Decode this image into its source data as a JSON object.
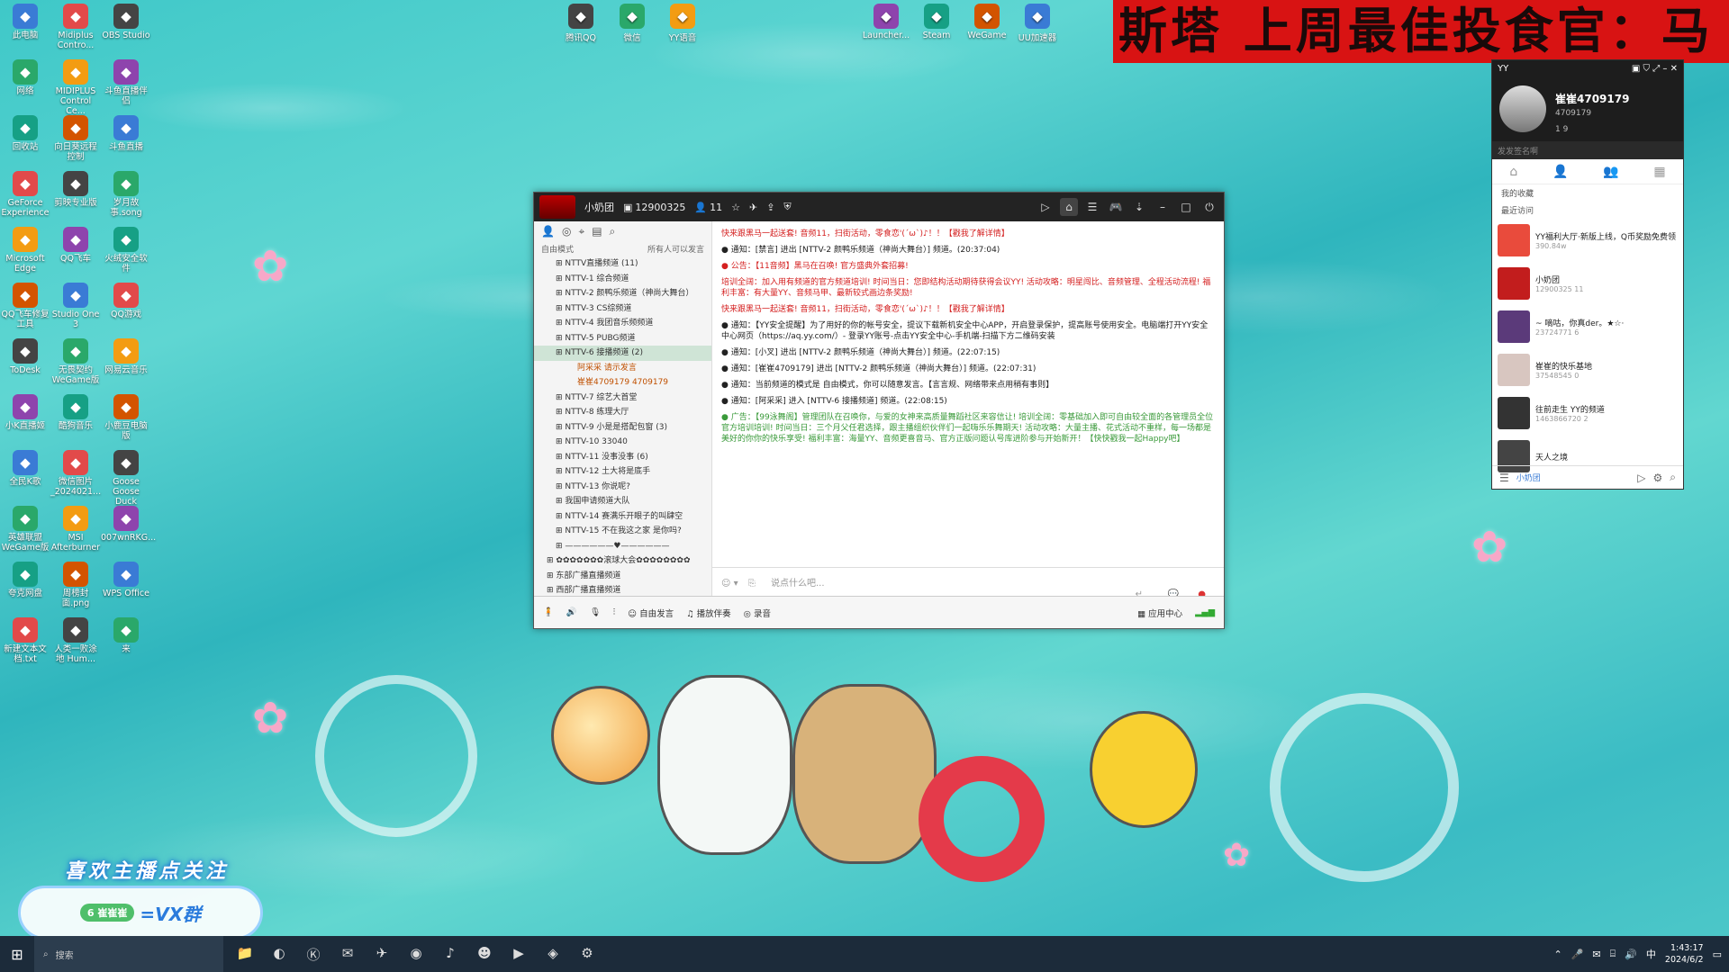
{
  "banner": {
    "text": "斯塔 上周最佳投食官：马"
  },
  "desktop_icons_left": [
    {
      "label": "此电脑",
      "icon": "computer-icon"
    },
    {
      "label": "Midiplus Contro...",
      "icon": "midi-icon"
    },
    {
      "label": "OBS Studio",
      "icon": "obs-icon"
    },
    {
      "label": "网络",
      "icon": "network-icon"
    },
    {
      "label": "MIDIPLUS Control Ce...",
      "icon": "midi-icon"
    },
    {
      "label": "斗鱼直播伴侣",
      "icon": "douyu-icon"
    },
    {
      "label": "回收站",
      "icon": "recycle-icon"
    },
    {
      "label": "向日葵远程控制",
      "icon": "sunflower-icon"
    },
    {
      "label": "斗鱼直播",
      "icon": "douyu-icon"
    },
    {
      "label": "GeForce Experience",
      "icon": "nvidia-icon"
    },
    {
      "label": "剪映专业版",
      "icon": "jianying-icon"
    },
    {
      "label": "岁月故事.song",
      "icon": "file-icon"
    },
    {
      "label": "Microsoft Edge",
      "icon": "edge-icon"
    },
    {
      "label": "QQ飞车",
      "icon": "qqspeed-icon"
    },
    {
      "label": "火绒安全软件",
      "icon": "huorong-icon"
    },
    {
      "label": "QQ飞车修复工具",
      "icon": "qqspeed-icon"
    },
    {
      "label": "Studio One 3",
      "icon": "studioone-icon"
    },
    {
      "label": "QQ游戏",
      "icon": "qqgame-icon"
    },
    {
      "label": "ToDesk",
      "icon": "todesk-icon"
    },
    {
      "label": "无畏契约 WeGame版",
      "icon": "valorant-icon"
    },
    {
      "label": "网易云音乐",
      "icon": "netease-icon"
    },
    {
      "label": "小K直播姬",
      "icon": "live-icon"
    },
    {
      "label": "酷狗音乐",
      "icon": "kugou-icon"
    },
    {
      "label": "小鹿豆电脑版",
      "icon": "app-icon"
    },
    {
      "label": "全民K歌",
      "icon": "ksong-icon"
    },
    {
      "label": "微信图片_2024021...",
      "icon": "image-icon"
    },
    {
      "label": "Goose Goose Duck",
      "icon": "goose-icon"
    },
    {
      "label": "英雄联盟 WeGame版",
      "icon": "lol-icon"
    },
    {
      "label": "MSI Afterburner",
      "icon": "msi-icon"
    },
    {
      "label": "007wnRKG...",
      "icon": "file-icon"
    },
    {
      "label": "夸克网盘",
      "icon": "quark-icon"
    },
    {
      "label": "周榜封面.png",
      "icon": "image-icon"
    },
    {
      "label": "WPS Office",
      "icon": "wps-icon"
    },
    {
      "label": "新建文本文档.txt",
      "icon": "txt-icon"
    },
    {
      "label": "人类一败涂地 Hum...",
      "icon": "human-icon"
    },
    {
      "label": "来",
      "icon": "file-icon"
    }
  ],
  "desktop_icons_top": [
    {
      "label": "腾讯QQ",
      "icon": "qq-icon"
    },
    {
      "label": "微信",
      "icon": "wechat-icon"
    },
    {
      "label": "YY语音",
      "icon": "yy-icon"
    },
    {
      "label": "Launcher...",
      "icon": "launcher-icon"
    },
    {
      "label": "Steam",
      "icon": "steam-icon"
    },
    {
      "label": "WeGame",
      "icon": "wegame-icon"
    },
    {
      "label": "UU加速器",
      "icon": "uu-icon"
    }
  ],
  "yy_main": {
    "channel_name": "小奶团",
    "channel_id": "12900325",
    "online_count": "11",
    "left_panel": {
      "mode": "自由模式",
      "mode_hint": "所有人可以发言",
      "channels": [
        {
          "label": "NTTV直播频道",
          "count": "(11)"
        },
        {
          "label": "NTTV-1 综合频道"
        },
        {
          "label": "NTTV-2 颜鸭乐频道（神尚大舞台）"
        },
        {
          "label": "NTTV-3 CS综频道"
        },
        {
          "label": "NTTV-4 我团音乐频频道"
        },
        {
          "label": "NTTV-5 PUBG频道"
        },
        {
          "label": "NTTV-6 接播频道",
          "count": "(2)",
          "selected": true
        },
        {
          "label": "阿采采",
          "user": true,
          "note": "请示发言"
        },
        {
          "label": "崔崔4709179",
          "user": true,
          "note": "4709179"
        },
        {
          "label": "NTTV-7 综艺大首堂"
        },
        {
          "label": "NTTV-8 练理大厅"
        },
        {
          "label": "NTTV-9 小是是搭配包窗",
          "count": "(3)"
        },
        {
          "label": "NTTV-10 33040"
        },
        {
          "label": "NTTV-11 没事没事",
          "count": "(6)"
        },
        {
          "label": "NTTV-12 土大将是底手"
        },
        {
          "label": "NTTV-13 你说呢?"
        },
        {
          "label": "我国申请频道大队"
        },
        {
          "label": "NTTV-14 赛满乐开眼子的叫肆空"
        },
        {
          "label": "NTTV-15 不在我这之家 是你吗?"
        },
        {
          "label": "——————♥——————"
        },
        {
          "label": "✿✿✿✿✿✿✿滚球大会✿✿✿✿✿✿✿✿",
          "cat": true
        },
        {
          "label": "东部广播直播频道",
          "cat": true
        },
        {
          "label": "西部广播直播频道",
          "cat": true
        }
      ]
    },
    "messages": [
      {
        "cls": "red",
        "text": "快来跟黑马一起送套! 音频11，扫街活动，零食恋'(´ω`)♪！！【戳我了解详情】"
      },
      {
        "cls": "blk",
        "text": "● 通知：[禁言] 进出 [NTTV-2 颜鸭乐频道（神尚大舞台）] 频道。(20:37:04)"
      },
      {
        "cls": "red",
        "text": "● 公告：【11音频】黑马在召唤! 官方盛典外套招募!"
      },
      {
        "cls": "red",
        "text": "培训全阔：加入用有频道的官方频道培训! 时间当日：您即结构活动期待获得会议YY! 活动攻略：明星闯比、音频管理、全程活动流程! 福利丰富：有大量YY、音频马甲、最新较式画边条奖励!"
      },
      {
        "cls": "red",
        "text": "快来跟黑马一起送套! 音频11，扫街活动，零食恋'(´ω`)♪！！【戳我了解详情】"
      },
      {
        "cls": "blk",
        "text": "● 通知：【YY安全提醒】为了用好的你的帐号安全，提议下载新机安全中心APP，开启登录保护，提高账号使用安全。电脑端打开YY安全中心网页（https://aq.yy.com/）- 登录YY账号-点击YY安全中心-手机端-扫描下方二维码安装"
      },
      {
        "cls": "blk",
        "text": "● 通知：[小叉] 进出 [NTTV-2 颜鸭乐频道（神尚大舞台）] 频道。(22:07:15)"
      },
      {
        "cls": "blk",
        "text": "● 通知：[崔崔4709179] 进出 [NTTV-2 颜鸭乐频道（神尚大舞台）] 频道。(22:07:31)"
      },
      {
        "cls": "blk",
        "text": "● 通知：当前频道的模式是 自由模式，你可以随意发言。【言言规、网络带来点用稍有事则】"
      },
      {
        "cls": "blk",
        "text": "● 通知：[阿采采] 进入 [NTTV-6 接播频道] 频道。(22:08:15)"
      },
      {
        "cls": "grn",
        "text": "● 广告：【99泳舞阁】管理团队在召唤你，与爱的女神来高质量舞蹈社区来容信让! 培训全阔：零基础加入即可自由较全面的各管理员全位官方培训培训! 时间当日：三个月父任君选择，跟主播组织伙伴们一起嗨乐乐舞期天! 活动攻略：大量主播、花式活动不重样，每一场都是美好的你你的快乐享受! 福利丰富：海量YY、音频更喜音马、官方正版问题认号库进阶参与开始新开！【快快戳我一起Happy吧】"
      }
    ],
    "input_placeholder": "说点什么吧...",
    "bottom": {
      "free_speak": "自由发言",
      "music": "播放伴奏",
      "record": "录音",
      "app_center": "应用中心"
    }
  },
  "yy_mini": {
    "title": "YY",
    "name": "崔崔4709179",
    "id": "4709179",
    "signature": "发发签名啊",
    "stats": "1  9",
    "sections": {
      "favorites": "我的收藏",
      "recent": "最近访问"
    },
    "recent": [
      {
        "title": "YY福利大厅·新版上线，Q币奖励免费领",
        "sub": "390.84w"
      },
      {
        "title": "小奶团",
        "sub": "12900325  11"
      },
      {
        "title": "~ 嘀咕，你真der。★☆·",
        "sub": "23724771  6"
      },
      {
        "title": "崔崔的快乐基地",
        "sub": "37548545  0"
      },
      {
        "title": "往前走生 YY的频道",
        "sub": "1463866720  2"
      },
      {
        "title": "天人之境",
        "sub": ""
      }
    ],
    "foot_label": "小奶团"
  },
  "overlay": {
    "follow_text": "喜欢主播点关注",
    "pill": "6 崔崔崔",
    "vx": "=VX群"
  },
  "taskbar": {
    "search_placeholder": "搜索",
    "time": "1:43:17",
    "date": "2024/6/2",
    "ime": "中"
  }
}
